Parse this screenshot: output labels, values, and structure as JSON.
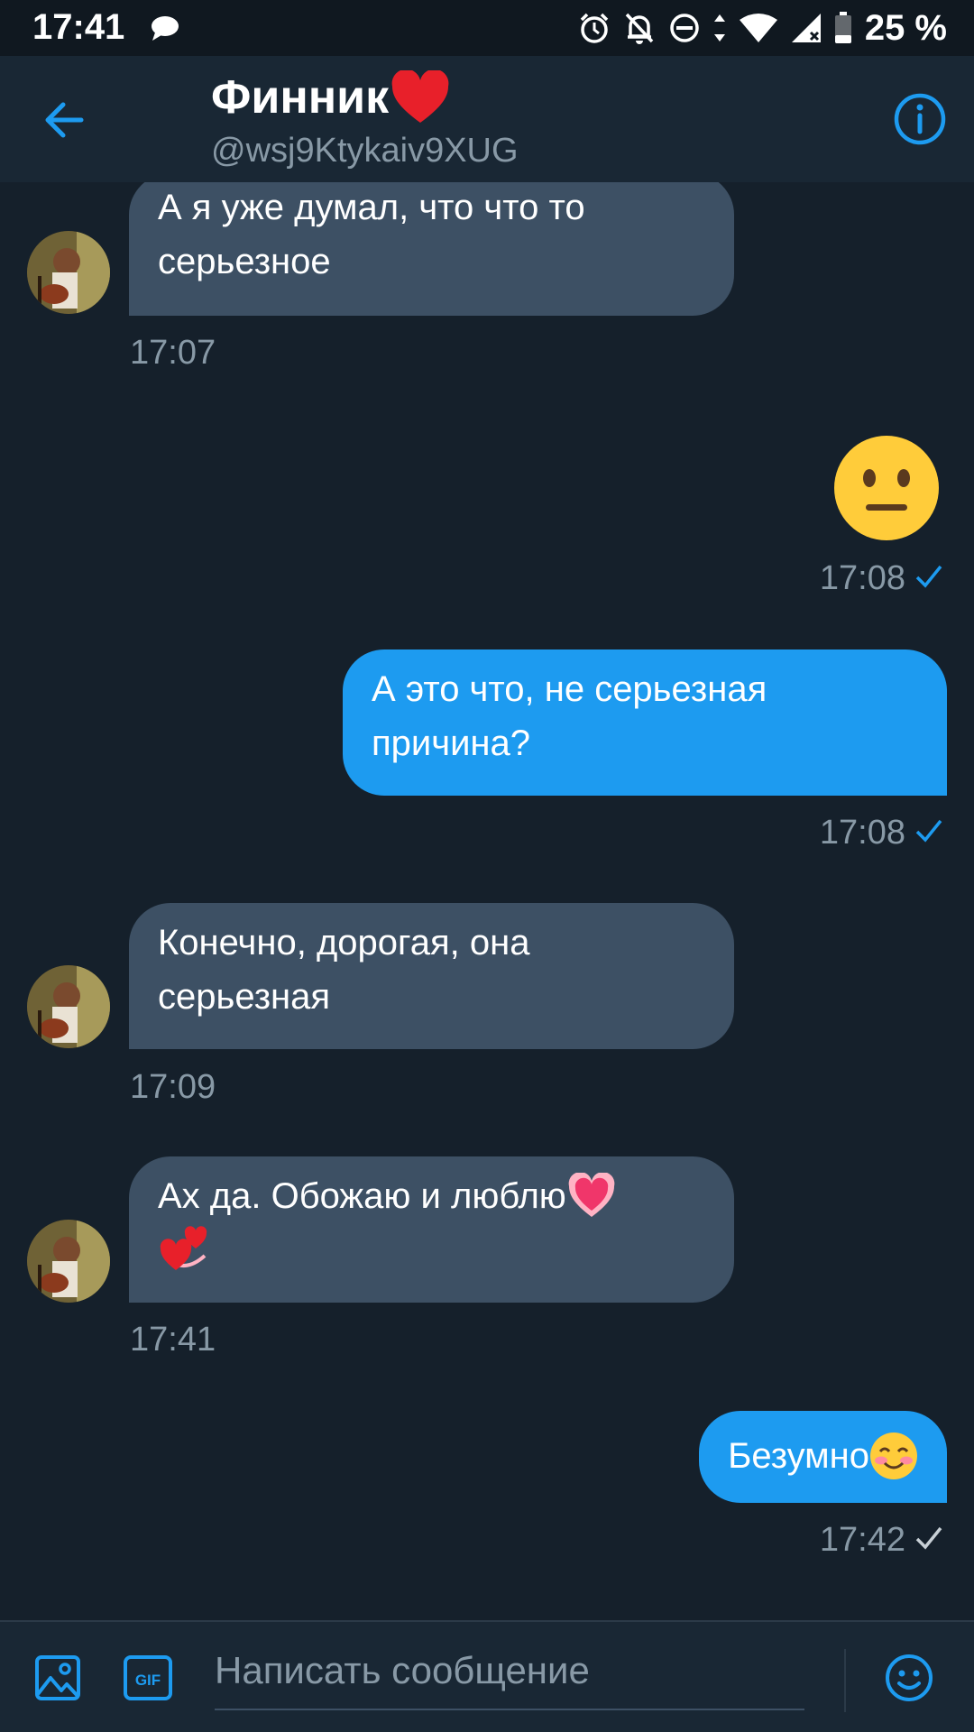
{
  "status_bar": {
    "time": "17:41",
    "battery": "25 %",
    "icons": [
      "chat-bubble-icon",
      "alarm-icon",
      "notifications-off-icon",
      "do-not-disturb-icon",
      "data-arrows-icon",
      "wifi-icon",
      "signal-icon",
      "battery-icon"
    ]
  },
  "header": {
    "name": "Финник",
    "handle": "@wsj9Ktykaiv9XUG",
    "icons": {
      "back": "arrow-left-icon",
      "info": "info-circle-icon"
    }
  },
  "messages": [
    {
      "direction": "incoming",
      "lines": [
        "А я уже думал, что что то",
        "серьезное"
      ],
      "time": "17:07"
    },
    {
      "direction": "outgoing",
      "type": "emoji",
      "emoji": "neutral-face-emoji",
      "time": "17:08",
      "status": "read"
    },
    {
      "direction": "outgoing",
      "lines": [
        "А это что, не серьезная",
        "причина?"
      ],
      "time": "17:08",
      "status": "read"
    },
    {
      "direction": "incoming",
      "lines": [
        "Конечно, дорогая, она",
        "серьезная"
      ],
      "time": "17:09"
    },
    {
      "direction": "incoming",
      "lines": [
        "Ах да. Обожаю и люблю",
        ""
      ],
      "trailing_emojis": [
        "glowing-heart-emoji",
        "revolving-hearts-emoji"
      ],
      "time": "17:41"
    },
    {
      "direction": "outgoing",
      "lines": [
        "Безумно"
      ],
      "trailing_emojis": [
        "smiling-blushing-emoji"
      ],
      "time": "17:42",
      "status": "sent"
    }
  ],
  "composer": {
    "placeholder": "Написать сообщение",
    "gif_label": "GIF"
  },
  "colors": {
    "background": "#15202b",
    "header": "#192734",
    "incoming_bubble": "#3d5064",
    "outgoing_bubble": "#1d9bf0",
    "accent": "#1d9bf0",
    "muted_text": "#8899a6"
  }
}
